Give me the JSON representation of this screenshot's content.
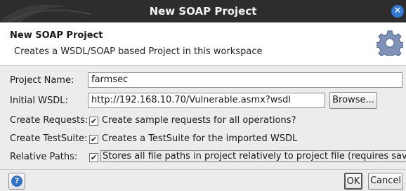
{
  "window": {
    "title": "New SOAP Project"
  },
  "header": {
    "title": "New SOAP Project",
    "subtitle": "Creates a WSDL/SOAP based Project in this workspace"
  },
  "form": {
    "project_name": {
      "label": "Project Name:",
      "value": "farmsec"
    },
    "initial_wsdl": {
      "label": "Initial WSDL:",
      "value": "http://192.168.10.70/Vulnerable.asmx?wsdl",
      "browse_label": "Browse..."
    },
    "create_requests": {
      "label": "Create Requests:",
      "checked": true,
      "text": "Create sample requests for all operations?"
    },
    "create_testsuite": {
      "label": "Create TestSuite:",
      "checked": true,
      "text": "Creates a TestSuite for the imported WSDL"
    },
    "relative_paths": {
      "label": "Relative Paths:",
      "checked": true,
      "text": "Stores all file paths in project relatively to project file (requires save)"
    }
  },
  "footer": {
    "help_icon": "?",
    "ok_label": "OK",
    "cancel_label": "Cancel"
  },
  "icons": {
    "close": "close-icon",
    "gear": "gear-icon",
    "help": "help-icon"
  },
  "colors": {
    "titlebar": "#2d2d2d",
    "accent": "#2f78d6",
    "dialog_bg": "#ececec"
  }
}
